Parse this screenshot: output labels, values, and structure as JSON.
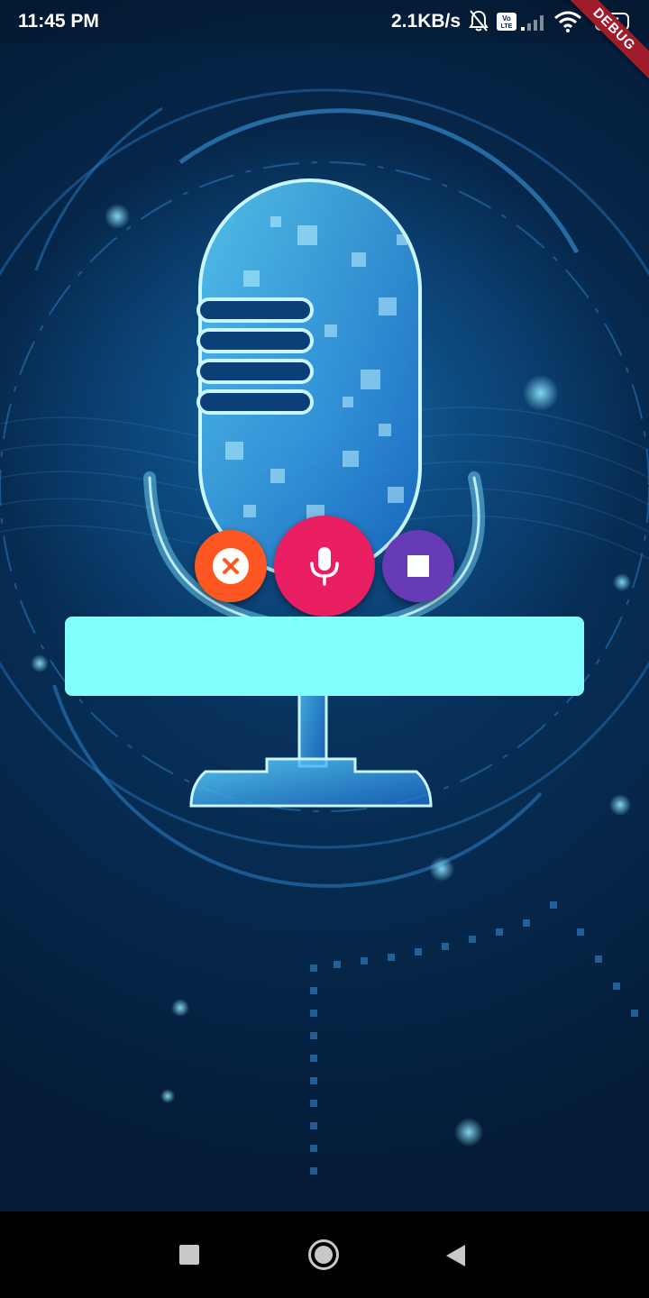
{
  "status_bar": {
    "time": "11:45 PM",
    "network_speed": "2.1KB/s",
    "battery_level": "67",
    "icons": [
      "notifications-off-icon",
      "volte-icon",
      "signal-icon",
      "wifi-icon",
      "battery-icon"
    ]
  },
  "debug_banner": {
    "label": "DEBUG"
  },
  "controls": {
    "cancel": {
      "icon": "close-circle-icon",
      "color": "#fe5722"
    },
    "record": {
      "icon": "microphone-icon",
      "color": "#e91e63"
    },
    "stop": {
      "icon": "stop-icon",
      "color": "#673ab7"
    }
  },
  "transcript": {
    "text": "",
    "background": "#84ffff"
  },
  "background": {
    "image": "glowing-microphone-illustration"
  },
  "nav_bar": {
    "buttons": [
      "recents-square-icon",
      "home-circle-icon",
      "back-triangle-icon"
    ]
  }
}
